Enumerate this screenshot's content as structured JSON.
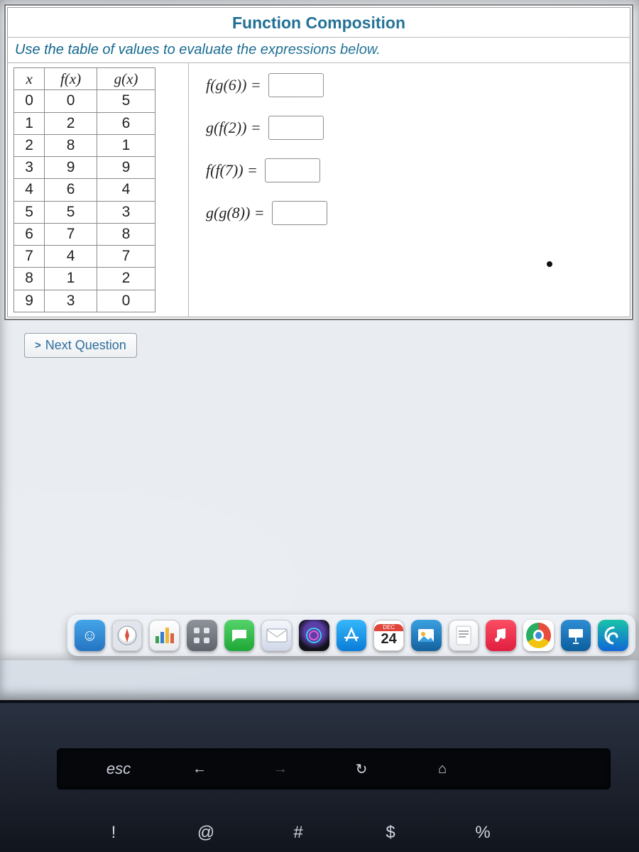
{
  "title": "Function Composition",
  "instruction": "Use the table of values to evaluate the expressions below.",
  "table": {
    "headers": [
      "x",
      "f(x)",
      "g(x)"
    ],
    "rows": [
      {
        "x": 0,
        "f": 0,
        "g": 5
      },
      {
        "x": 1,
        "f": 2,
        "g": 6
      },
      {
        "x": 2,
        "f": 8,
        "g": 1
      },
      {
        "x": 3,
        "f": 9,
        "g": 9
      },
      {
        "x": 4,
        "f": 6,
        "g": 4
      },
      {
        "x": 5,
        "f": 5,
        "g": 3
      },
      {
        "x": 6,
        "f": 7,
        "g": 8
      },
      {
        "x": 7,
        "f": 4,
        "g": 7
      },
      {
        "x": 8,
        "f": 1,
        "g": 2
      },
      {
        "x": 9,
        "f": 3,
        "g": 0
      }
    ]
  },
  "questions": [
    {
      "label": "f(g(6)) =",
      "value": ""
    },
    {
      "label": "g(f(2)) =",
      "value": ""
    },
    {
      "label": "f(f(7)) =",
      "value": ""
    },
    {
      "label": "g(g(8)) =",
      "value": ""
    }
  ],
  "next_button": {
    "chevron": ">",
    "label": "Next Question"
  },
  "dock": {
    "calendar": {
      "month": "DEC",
      "day": "24"
    }
  },
  "touchbar": {
    "esc": "esc",
    "back": "←",
    "forward": "→",
    "reload": "↻",
    "home": "⌂"
  },
  "keyrow": {
    "k1": "!",
    "k2": "@",
    "k3": "#",
    "k4": "$",
    "k5": "%"
  }
}
